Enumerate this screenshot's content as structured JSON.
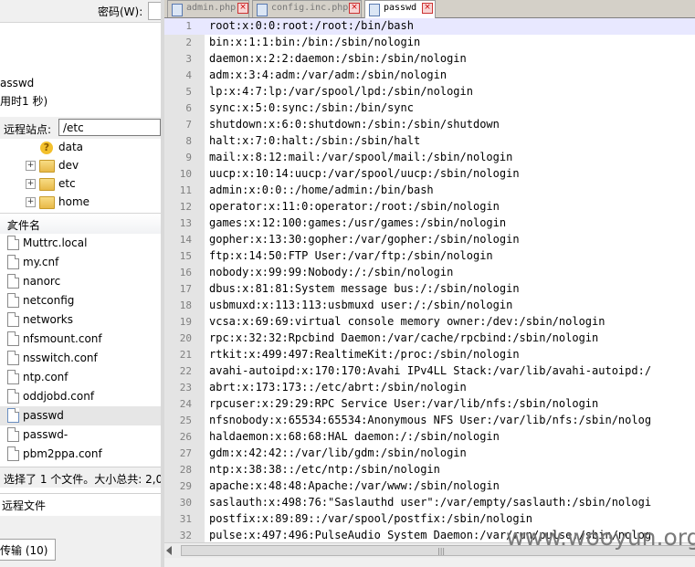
{
  "left_panel": {
    "password_label": "密码(W):",
    "log_lines": [
      "asswd",
      "用时1 秒)"
    ],
    "remote_site_label": "远程站点:",
    "remote_site_value": "/etc",
    "tree_items": [
      {
        "name": "data",
        "icon": "question-icon"
      },
      {
        "name": "dev",
        "icon": "folder-icon"
      },
      {
        "name": "etc",
        "icon": "folder-icon"
      },
      {
        "name": "home",
        "icon": "folder-icon"
      }
    ],
    "file_column_header": "文件名",
    "files": [
      "Muttrc.local",
      "my.cnf",
      "nanorc",
      "netconfig",
      "networks",
      "nfsmount.conf",
      "nsswitch.conf",
      "ntp.conf",
      "oddjobd.conf",
      "passwd",
      "passwd-",
      "pbm2ppa.conf"
    ],
    "selected_file": "passwd",
    "selection_status": "选择了 1 个文件。大小总共: 2,0",
    "remote_files_label": "远程文件",
    "transfer_tab_label": "传输 (10)"
  },
  "editor": {
    "tabs": [
      {
        "label": "admin.php",
        "active": false
      },
      {
        "label": "config.inc.php",
        "active": false
      },
      {
        "label": "passwd",
        "active": true
      }
    ],
    "lines": [
      "root:x:0:0:root:/root:/bin/bash",
      "bin:x:1:1:bin:/bin:/sbin/nologin",
      "daemon:x:2:2:daemon:/sbin:/sbin/nologin",
      "adm:x:3:4:adm:/var/adm:/sbin/nologin",
      "lp:x:4:7:lp:/var/spool/lpd:/sbin/nologin",
      "sync:x:5:0:sync:/sbin:/bin/sync",
      "shutdown:x:6:0:shutdown:/sbin:/sbin/shutdown",
      "halt:x:7:0:halt:/sbin:/sbin/halt",
      "mail:x:8:12:mail:/var/spool/mail:/sbin/nologin",
      "uucp:x:10:14:uucp:/var/spool/uucp:/sbin/nologin",
      "admin:x:0:0::/home/admin:/bin/bash",
      "operator:x:11:0:operator:/root:/sbin/nologin",
      "games:x:12:100:games:/usr/games:/sbin/nologin",
      "gopher:x:13:30:gopher:/var/gopher:/sbin/nologin",
      "ftp:x:14:50:FTP User:/var/ftp:/sbin/nologin",
      "nobody:x:99:99:Nobody:/:/sbin/nologin",
      "dbus:x:81:81:System message bus:/:/sbin/nologin",
      "usbmuxd:x:113:113:usbmuxd user:/:/sbin/nologin",
      "vcsa:x:69:69:virtual console memory owner:/dev:/sbin/nologin",
      "rpc:x:32:32:Rpcbind Daemon:/var/cache/rpcbind:/sbin/nologin",
      "rtkit:x:499:497:RealtimeKit:/proc:/sbin/nologin",
      "avahi-autoipd:x:170:170:Avahi IPv4LL Stack:/var/lib/avahi-autoipd:/",
      "abrt:x:173:173::/etc/abrt:/sbin/nologin",
      "rpcuser:x:29:29:RPC Service User:/var/lib/nfs:/sbin/nologin",
      "nfsnobody:x:65534:65534:Anonymous NFS User:/var/lib/nfs:/sbin/nolog",
      "haldaemon:x:68:68:HAL daemon:/:/sbin/nologin",
      "gdm:x:42:42::/var/lib/gdm:/sbin/nologin",
      "ntp:x:38:38::/etc/ntp:/sbin/nologin",
      "apache:x:48:48:Apache:/var/www:/sbin/nologin",
      "saslauth:x:498:76:\"Saslauthd user\":/var/empty/saslauth:/sbin/nologi",
      "postfix:x:89:89::/var/spool/postfix:/sbin/nologin",
      "pulse:x:497:496:PulseAudio System Daemon:/var/run/pulse:/sbin/nolog"
    ],
    "current_line": 1
  },
  "watermark": "www.wooyun.org"
}
